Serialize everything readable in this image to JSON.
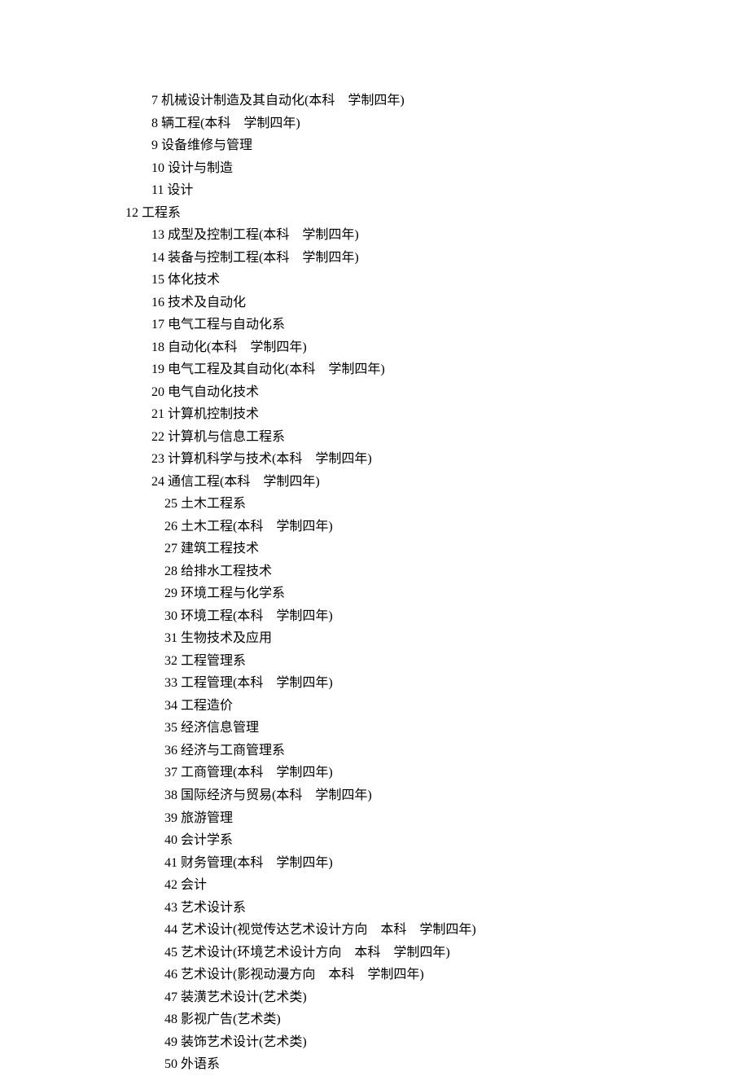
{
  "lines": [
    {
      "indent": "a",
      "text": "7 机械设计制造及其自动化(本科    学制四年)"
    },
    {
      "indent": "a",
      "text": "8 辆工程(本科    学制四年)"
    },
    {
      "indent": "a",
      "text": "9 设备维修与管理"
    },
    {
      "indent": "a",
      "text": "10 设计与制造"
    },
    {
      "indent": "a",
      "text": "11 设计"
    },
    {
      "indent": "b",
      "text": "12 工程系"
    },
    {
      "indent": "a",
      "text": "13 成型及控制工程(本科    学制四年)"
    },
    {
      "indent": "a",
      "text": "14 装备与控制工程(本科    学制四年)"
    },
    {
      "indent": "a",
      "text": "15 体化技术"
    },
    {
      "indent": "a",
      "text": "16 技术及自动化"
    },
    {
      "indent": "a",
      "text": "17 电气工程与自动化系"
    },
    {
      "indent": "a",
      "text": "18 自动化(本科    学制四年)"
    },
    {
      "indent": "a",
      "text": "19 电气工程及其自动化(本科    学制四年)"
    },
    {
      "indent": "a",
      "text": "20 电气自动化技术"
    },
    {
      "indent": "a",
      "text": "21 计算机控制技术"
    },
    {
      "indent": "a",
      "text": "22 计算机与信息工程系"
    },
    {
      "indent": "a",
      "text": "23 计算机科学与技术(本科    学制四年)"
    },
    {
      "indent": "a",
      "text": "24 通信工程(本科    学制四年)"
    },
    {
      "indent": "c",
      "text": "25 土木工程系"
    },
    {
      "indent": "c",
      "text": "26 土木工程(本科    学制四年)"
    },
    {
      "indent": "c",
      "text": "27 建筑工程技术"
    },
    {
      "indent": "c",
      "text": "28 给排水工程技术"
    },
    {
      "indent": "c",
      "text": "29 环境工程与化学系"
    },
    {
      "indent": "c",
      "text": "30 环境工程(本科    学制四年)"
    },
    {
      "indent": "c",
      "text": "31 生物技术及应用"
    },
    {
      "indent": "c",
      "text": "32 工程管理系"
    },
    {
      "indent": "c",
      "text": "33 工程管理(本科    学制四年)"
    },
    {
      "indent": "c",
      "text": "34 工程造价"
    },
    {
      "indent": "c",
      "text": "35 经济信息管理"
    },
    {
      "indent": "c",
      "text": "36 经济与工商管理系"
    },
    {
      "indent": "c",
      "text": "37 工商管理(本科    学制四年)"
    },
    {
      "indent": "c",
      "text": "38 国际经济与贸易(本科    学制四年)"
    },
    {
      "indent": "c",
      "text": "39 旅游管理"
    },
    {
      "indent": "c",
      "text": "40 会计学系"
    },
    {
      "indent": "c",
      "text": "41 财务管理(本科    学制四年)"
    },
    {
      "indent": "c",
      "text": "42 会计"
    },
    {
      "indent": "c",
      "text": "43 艺术设计系"
    },
    {
      "indent": "c",
      "text": "44 艺术设计(视觉传达艺术设计方向    本科    学制四年)"
    },
    {
      "indent": "c",
      "text": "45 艺术设计(环境艺术设计方向    本科    学制四年)"
    },
    {
      "indent": "c",
      "text": "46 艺术设计(影视动漫方向    本科    学制四年)"
    },
    {
      "indent": "c",
      "text": "47 装潢艺术设计(艺术类)"
    },
    {
      "indent": "c",
      "text": "48 影视广告(艺术类)"
    },
    {
      "indent": "c",
      "text": "49 装饰艺术设计(艺术类)"
    },
    {
      "indent": "c",
      "text": "50 外语系"
    }
  ]
}
